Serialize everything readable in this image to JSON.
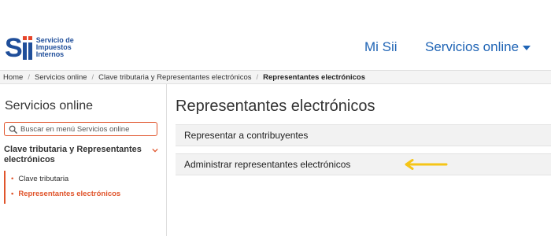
{
  "header": {
    "logo_text": [
      "Servicio de",
      "Impuestos",
      "Internos"
    ],
    "nav": [
      {
        "label": "Mi Sii"
      },
      {
        "label": "Servicios online"
      }
    ]
  },
  "breadcrumb": [
    {
      "label": "Home"
    },
    {
      "label": "Servicios online"
    },
    {
      "label": "Clave tributaria y Representantes electrónicos"
    },
    {
      "label": "Representantes electrónicos"
    }
  ],
  "sidebar": {
    "title": "Servicios online",
    "search_placeholder": "Buscar en menú Servicios online",
    "section_label": "Clave tributaria y Representantes electrónicos",
    "items": [
      {
        "label": "Clave tributaria"
      },
      {
        "label": "Representantes electrónicos"
      }
    ]
  },
  "main": {
    "title": "Representantes electrónicos",
    "options": [
      {
        "label": "Representar a contribuyentes"
      },
      {
        "label": "Administrar representantes electrónicos"
      }
    ]
  },
  "colors": {
    "brand_blue": "#1f4e9a",
    "link_blue": "#1f64b5",
    "accent_orange": "#e0542b",
    "arrow_yellow": "#f5c518"
  }
}
